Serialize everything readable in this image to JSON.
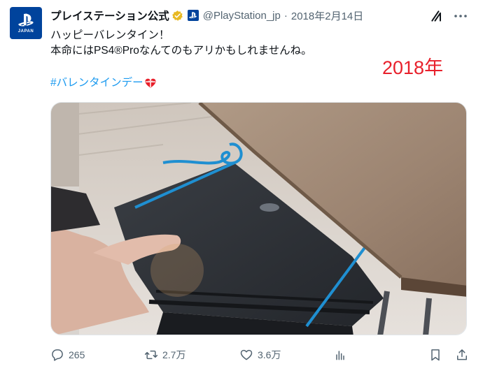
{
  "author": {
    "display_name": "プレイステーション公式",
    "handle": "@PlayStation_jp",
    "avatar_text": "JAPAN",
    "verified": true
  },
  "post": {
    "separator": "·",
    "date": "2018年2月14日",
    "lines": [
      "ハッピーバレンタイン！",
      "本命にはPS4®Proなんてのもアリかもしれませんね。"
    ],
    "hashtag": "#バレンタインデー",
    "hashtag_emoji": "heart-ribbon-emoji",
    "overlay_annotation": "2018年"
  },
  "media": {
    "description_icon": "photo"
  },
  "actions": {
    "replies": "265",
    "reposts": "2.7万",
    "likes": "3.6万"
  },
  "colors": {
    "accent": "#1d9bf0",
    "annotation": "#e8202b",
    "brand": "#00439c",
    "muted": "#536471"
  }
}
